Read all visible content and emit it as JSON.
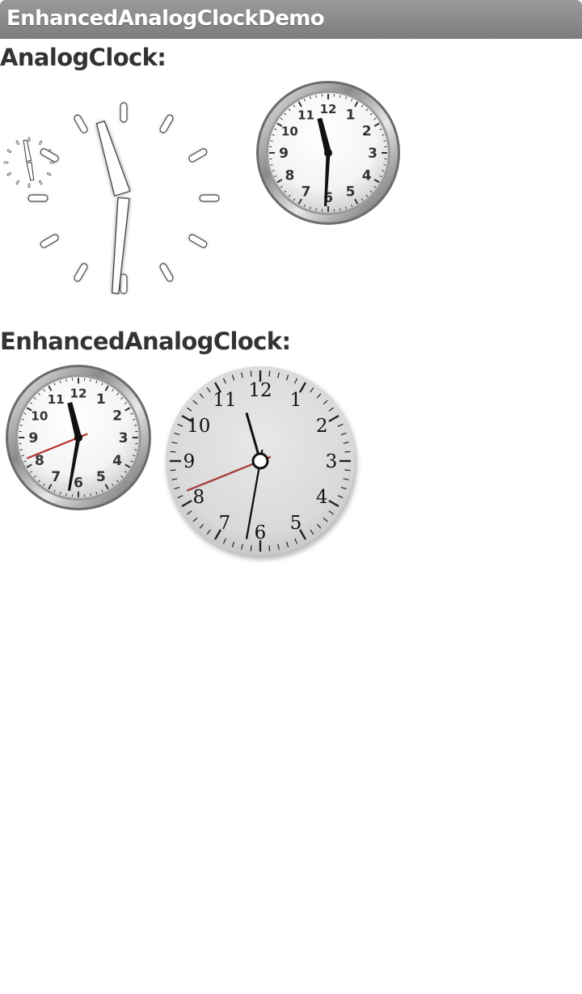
{
  "app": {
    "title": "EnhancedAnalogClockDemo"
  },
  "sections": [
    {
      "label": "AnalogClock:"
    },
    {
      "label": "EnhancedAnalogClock:"
    }
  ],
  "clock_dial": {
    "chrome_numbers": [
      "12",
      "1",
      "2",
      "3",
      "4",
      "5",
      "6",
      "7",
      "8",
      "9",
      "10",
      "11"
    ],
    "plain_numbers": [
      "12",
      "1",
      "2",
      "3",
      "4",
      "5",
      "6",
      "7",
      "8",
      "9",
      "10",
      "11"
    ]
  }
}
